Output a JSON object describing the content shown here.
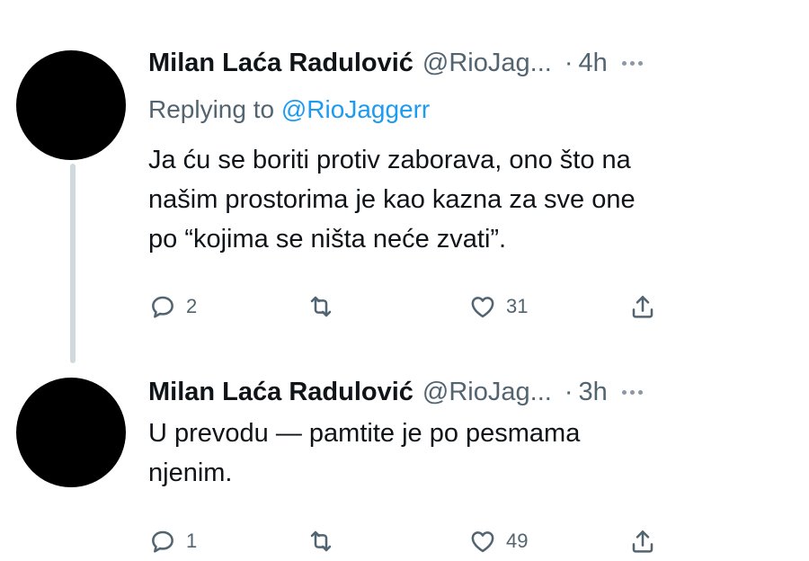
{
  "tweets": [
    {
      "display_name": "Milan Laća Radulović",
      "handle": "@RioJag...",
      "dot": "·",
      "time": "4h",
      "replying_prefix": "Replying to ",
      "replying_to": "@RioJaggerr",
      "lines": [
        "Ja ću se boriti protiv zaborava, ono što na",
        "našim prostorima je kao kazna za sve one",
        "po “kojima se ništa neće zvati”."
      ],
      "reply_count": "2",
      "retweet_count": "",
      "like_count": "31"
    },
    {
      "display_name": "Milan Laća Radulović",
      "handle": "@RioJag...",
      "dot": "·",
      "time": "3h",
      "lines": [
        "U prevodu — pamtite je po pesmama",
        "njenim."
      ],
      "reply_count": "1",
      "retweet_count": "",
      "like_count": "49"
    }
  ],
  "icons": {
    "reply": "reply-icon",
    "retweet": "retweet-icon",
    "like": "heart-icon",
    "share": "share-icon",
    "more": "more-icon"
  },
  "colors": {
    "text": "#0f1419",
    "secondary": "#536471",
    "mention": "#1d9bf0",
    "thread_line": "#cfd9de",
    "avatar": "#000000"
  }
}
